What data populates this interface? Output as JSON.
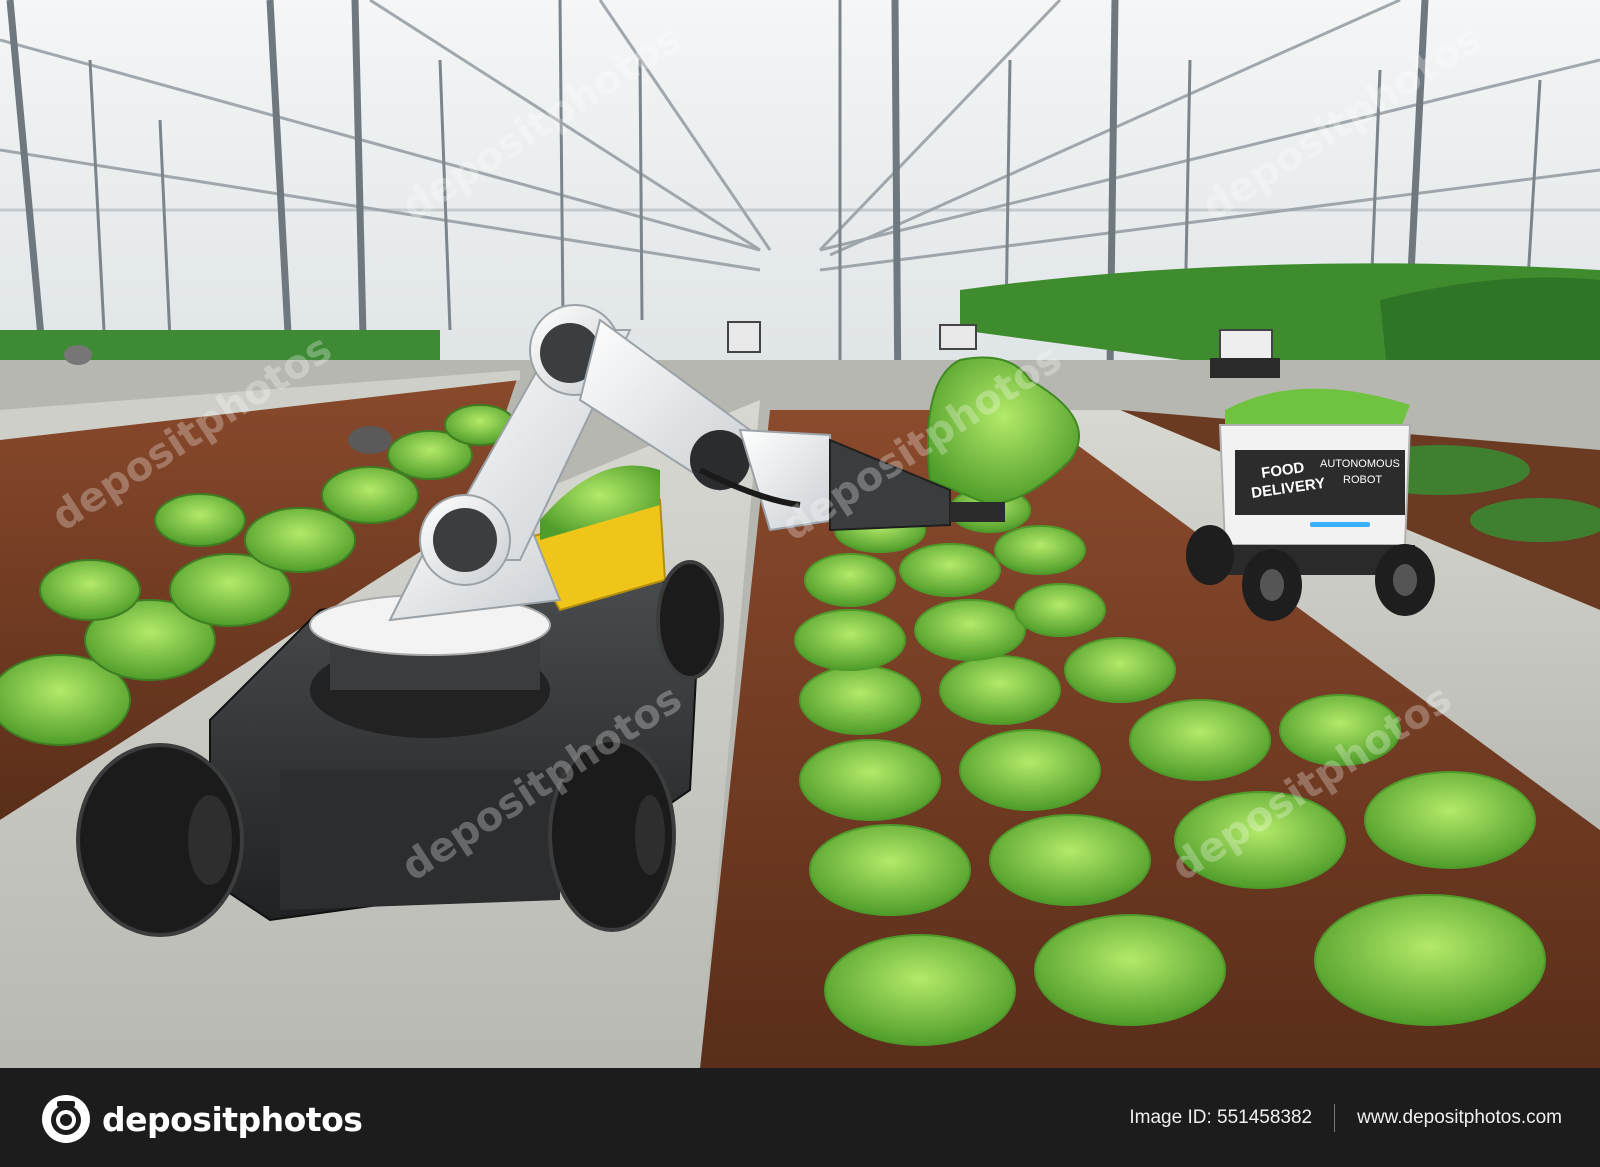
{
  "photo": {
    "scene": "Robotic arm harvesting lettuce in a greenhouse with an autonomous delivery robot",
    "robot_box_label_line1": "FOOD",
    "robot_box_label_line2": "DELIVERY",
    "robot_box_label_right1": "AUTONOMOUS",
    "robot_box_label_right2": "ROBOT",
    "watermark_text": "depositphotos"
  },
  "footer": {
    "brand_name": "depositphotos",
    "image_id_label": "Image ID: 551458382",
    "site_url": "www.depositphotos.com"
  },
  "colors": {
    "footer_bg": "#1c1c1c",
    "lettuce": "#7fcf45",
    "soil": "#6b3a22",
    "path": "#c9c9c4"
  }
}
